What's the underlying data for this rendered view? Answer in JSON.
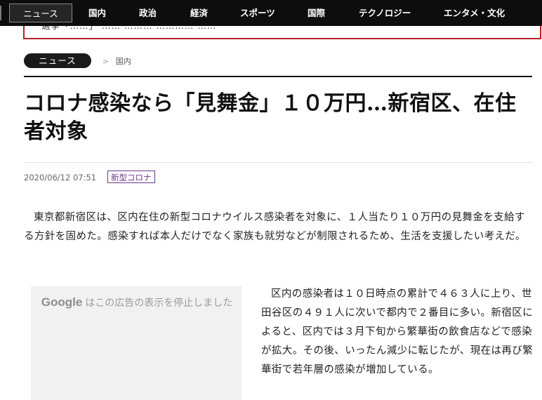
{
  "nav": {
    "items": [
      "ニュース",
      "国内",
      "政治",
      "経済",
      "スポーツ",
      "国際",
      "テクノロジー",
      "エンタメ・文化"
    ]
  },
  "banner": {
    "text": "選挙「……」 …… ……… ………… ……"
  },
  "category": {
    "label": "ニュース"
  },
  "breadcrumb": {
    "separator": ">",
    "current": "国内"
  },
  "article": {
    "headline": "コロナ感染なら「見舞金」１０万円…新宿区、在住者対象",
    "timestamp": "2020/06/12 07:51",
    "tag": "新型コロナ",
    "paragraphs": [
      "東京都新宿区は、区内在住の新型コロナウイルス感染者を対象に、１人当たり１０万円の見舞金を支給する方針を固めた。感染すれば本人だけでなく家族も就労などが制限されるため、生活を支援したい考えだ。",
      "区内の感染者は１０日時点の累計で４６３人に上り、世田谷区の４９１人に次いで都内で２番目に多い。新宿区によると、区内では３月下旬から繁華街の飲食店などで感染が拡大。その後、いったん減少に転じたが、現在は再び繁華街で若年層の感染が増加している。"
    ]
  },
  "ad": {
    "logo": "Google",
    "message": "はこの広告の表示を停止しました"
  },
  "colors": {
    "nav_bg": "#0d0d0d",
    "banner_border": "#b5222a",
    "tag_color": "#6a3a8a"
  }
}
